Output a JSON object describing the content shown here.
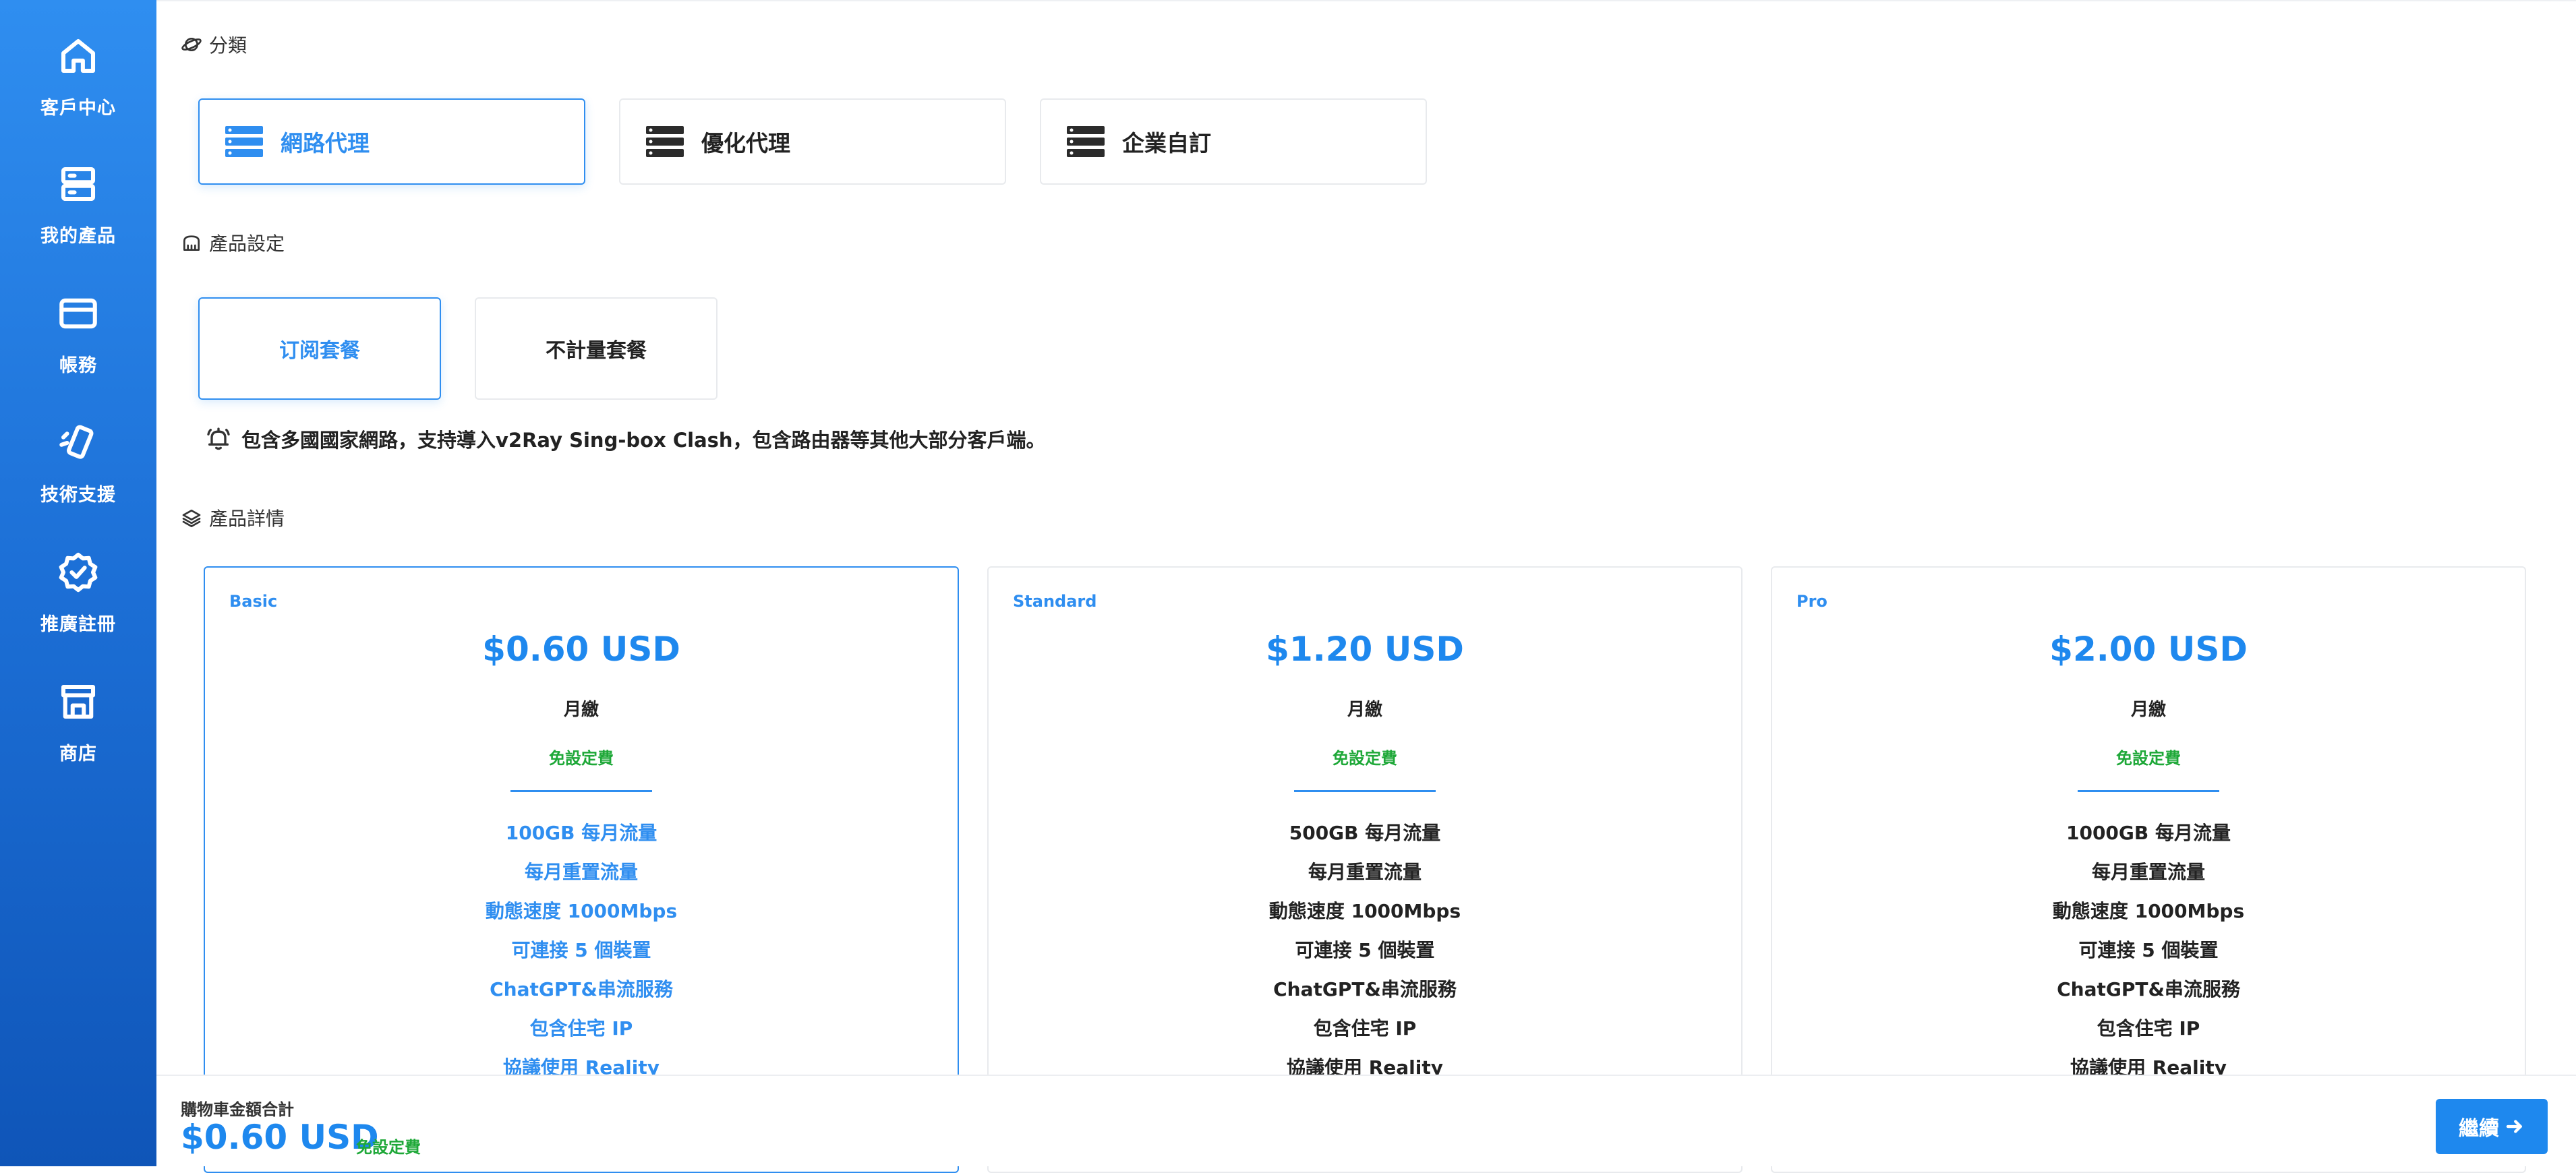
{
  "sidebar": {
    "items": [
      {
        "label": "客戶中心",
        "icon": "home-icon"
      },
      {
        "label": "我的產品",
        "icon": "server-icon"
      },
      {
        "label": "帳務",
        "icon": "credit-card-icon"
      },
      {
        "label": "技術支援",
        "icon": "support-icon"
      },
      {
        "label": "推廣註冊",
        "icon": "badge-check-icon"
      },
      {
        "label": "商店",
        "icon": "store-icon"
      }
    ]
  },
  "categories": {
    "title": "分類",
    "items": [
      {
        "label": "網路代理",
        "active": true
      },
      {
        "label": "優化代理",
        "active": false
      },
      {
        "label": "企業自訂",
        "active": false
      }
    ]
  },
  "product_settings": {
    "title": "產品設定",
    "options": [
      {
        "label": "订阅套餐",
        "active": true
      },
      {
        "label": "不計量套餐",
        "active": false
      }
    ],
    "notice": "包含多國國家網路，支持導入v2Ray Sing-box Clash，包含路由器等其他大部分客戶端。"
  },
  "product_details": {
    "title": "產品詳情",
    "plans": [
      {
        "tier": "Basic",
        "price": "$0.60 USD",
        "cycle": "月繳",
        "setup": "免設定費",
        "active": true,
        "features": [
          "100GB 每月流量",
          "每月重置流量",
          "動態速度 1000Mbps",
          "可連接 5 個裝置",
          "ChatGPT&串流服務",
          "包含住宅 IP",
          "協議使用 Reality"
        ]
      },
      {
        "tier": "Standard",
        "price": "$1.20 USD",
        "cycle": "月繳",
        "setup": "免設定費",
        "active": false,
        "features": [
          "500GB 每月流量",
          "每月重置流量",
          "動態速度 1000Mbps",
          "可連接 5 個裝置",
          "ChatGPT&串流服務",
          "包含住宅 IP",
          "協議使用 Reality"
        ]
      },
      {
        "tier": "Pro",
        "price": "$2.00 USD",
        "cycle": "月繳",
        "setup": "免設定費",
        "active": false,
        "features": [
          "1000GB 每月流量",
          "每月重置流量",
          "動態速度 1000Mbps",
          "可連接 5 個裝置",
          "ChatGPT&串流服務",
          "包含住宅 IP",
          "協議使用 Reality"
        ]
      }
    ]
  },
  "footer": {
    "total_label": "購物車金額合計",
    "total_price": "$0.60 USD",
    "setup_note": "免設定費",
    "continue_label": "繼續"
  },
  "colors": {
    "accent": "#1e88ee",
    "sidebar_top": "#2f8ef0",
    "sidebar_bottom": "#0f55b8",
    "success": "#1ea838"
  }
}
